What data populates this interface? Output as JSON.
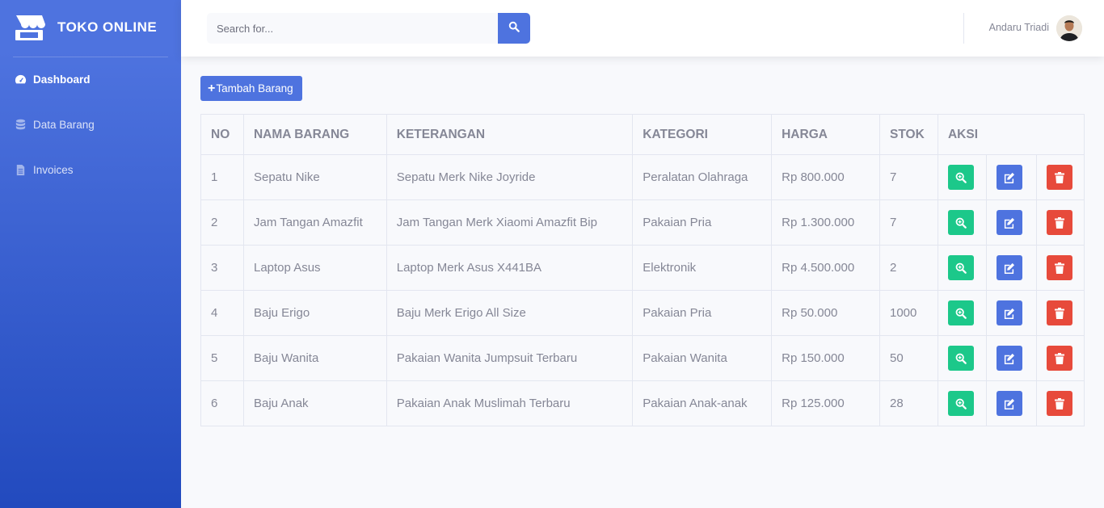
{
  "brand": {
    "title": "TOKO ONLINE"
  },
  "sidebar": {
    "items": [
      {
        "label": "Dashboard",
        "icon": "tachometer-icon"
      },
      {
        "label": "Data Barang",
        "icon": "database-icon"
      },
      {
        "label": "Invoices",
        "icon": "file-icon"
      }
    ]
  },
  "topbar": {
    "search_placeholder": "Search for...",
    "user_name": "Andaru Triadi"
  },
  "content": {
    "add_button_label": "Tambah Barang",
    "table": {
      "headers": [
        "NO",
        "NAMA BARANG",
        "KETERANGAN",
        "KATEGORI",
        "HARGA",
        "STOK",
        "AKSI"
      ],
      "rows": [
        [
          "1",
          "Sepatu Nike",
          "Sepatu Merk Nike Joyride",
          "Peralatan Olahraga",
          "Rp 800.000",
          "7"
        ],
        [
          "2",
          "Jam Tangan Amazfit",
          "Jam Tangan Merk Xiaomi Amazfit Bip",
          "Pakaian Pria",
          "Rp 1.300.000",
          "7"
        ],
        [
          "3",
          "Laptop Asus",
          "Laptop Merk Asus X441BA",
          "Elektronik",
          "Rp 4.500.000",
          "2"
        ],
        [
          "4",
          "Baju Erigo",
          "Baju Merk Erigo All Size",
          "Pakaian Pria",
          "Rp 50.000",
          "1000"
        ],
        [
          "5",
          "Baju Wanita",
          "Pakaian Wanita Jumpsuit Terbaru",
          "Pakaian Wanita",
          "Rp 150.000",
          "50"
        ],
        [
          "6",
          "Baju Anak",
          "Pakaian Anak Muslimah Terbaru",
          "Pakaian Anak-anak",
          "Rp 125.000",
          "28"
        ]
      ]
    }
  },
  "colors": {
    "primary": "#4e73df",
    "success": "#1cc88a",
    "danger": "#e74a3b",
    "text": "#858796"
  }
}
